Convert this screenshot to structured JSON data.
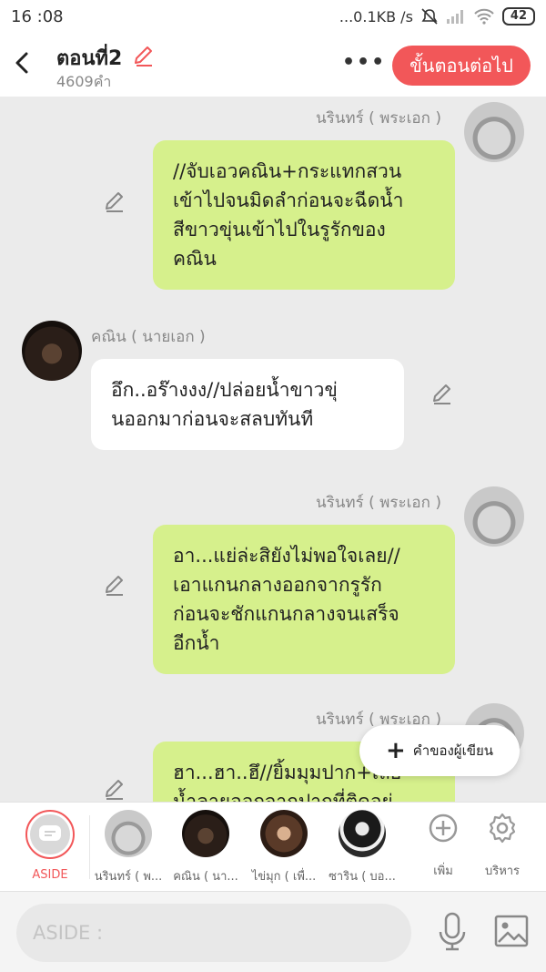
{
  "status_bar": {
    "time": "16 :08",
    "network": "...0.1KB /s",
    "battery": "42"
  },
  "header": {
    "title": "ตอนที่2",
    "word_count": "4609คำ",
    "more": "•••",
    "next_button": "ขั้นตอนต่อไป"
  },
  "messages": [
    {
      "sender": "นรินทร์ ( พระเอก )",
      "side": "right",
      "text_lines": [
        "//จับเอวคณิน+กระแทกสวน",
        "เข้าไปจนมิดลำก่อนจะฉีดน้ำ",
        "สีขาวขุ่นเข้าไปในรูรักของ",
        "คณิน"
      ]
    },
    {
      "sender": "คณิน ( นายเอก )",
      "side": "left",
      "text_lines": [
        "อึก..อร๊างงง//ปล่อยน้ำขาวขุ่",
        "นออกมาก่อนจะสลบทันที"
      ]
    },
    {
      "sender": "นรินทร์ ( พระเอก )",
      "side": "right",
      "text_lines": [
        "อา...แย่ล่ะสิยังไม่พอใจเลย//",
        "เอาแกนกลางออกจากรูรัก",
        "ก่อนจะชักแกนกลางจนเสร็จ",
        "อีกน้ำ"
      ]
    },
    {
      "sender": "นรินทร์ ( พระเอก )",
      "side": "right",
      "text_lines": [
        "ฮา...ฮา..ฮึ//ยิ้มมุมปาก+เลีย",
        "น้ำลายออกจากปากที่ติดอยู่"
      ]
    }
  ],
  "fab": {
    "label": "คำของผู้เขียน"
  },
  "characters": [
    {
      "label": "ASIDE"
    },
    {
      "label": "นรินทร์ ( พ..."
    },
    {
      "label": "คณิน ( นา..."
    },
    {
      "label": "ไข่มุก ( เพื่..."
    },
    {
      "label": "ซาริน ( บอ..."
    },
    {
      "label": "เพิ่ม"
    },
    {
      "label": "บริหาร"
    }
  ],
  "input": {
    "placeholder": "ASIDE :"
  },
  "colors": {
    "accent": "#f25759",
    "bubble_green": "#d6f08c",
    "background": "#ebebeb"
  },
  "icons": [
    "back-arrow-icon",
    "pencil-icon",
    "more-icon",
    "plus-icon",
    "add-circle-icon",
    "gear-icon",
    "microphone-icon",
    "image-icon",
    "chat-bubble-icon"
  ]
}
